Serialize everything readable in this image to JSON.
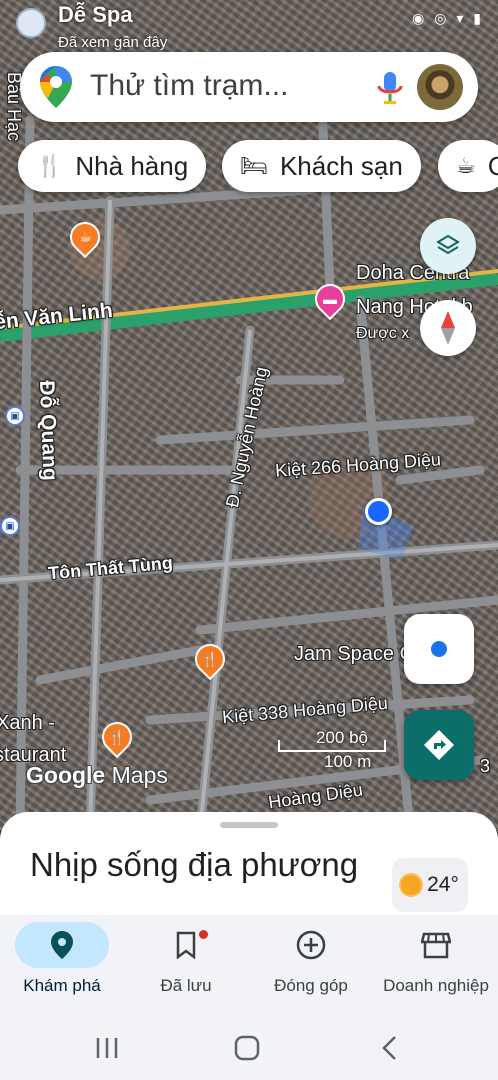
{
  "status_bar": {
    "place_name": "Dễ Spa",
    "recently_viewed": "Đã xem gần đây",
    "system_icons": "◉ ◎ ▾ ▮"
  },
  "search": {
    "placeholder": "Thử tìm trạm..."
  },
  "chips": [
    {
      "icon": "restaurant-icon",
      "label": "Nhà hàng"
    },
    {
      "icon": "hotel-icon",
      "label": "Khách sạn"
    },
    {
      "icon": "coffee-icon",
      "label": "C"
    }
  ],
  "map": {
    "streets": {
      "nguyen_van_linh": "ễn Văn Linh",
      "do_quang": "Đỗ Quang",
      "nguyen_hoang": "Đ. Nguyễn Hoàng",
      "kiet_266": "Kiệt 266 Hoàng Diệu",
      "ton_that_tung": "Tôn Thất Tùng",
      "kiet_338": "Kiệt 338 Hoàng Diệu",
      "hoang_dieu": "Hoàng Diệu",
      "bau_hac": "Bàu Hạc",
      "side_num": "3"
    },
    "pois": {
      "hotel_name_1": "Doha Centra",
      "hotel_name_2": "Nang Hotel b",
      "hotel_sub": "Được x",
      "jam_space": "Jam Space Cafe",
      "xanh_1": "Xanh -",
      "xanh_2": "staurant"
    },
    "scale": {
      "top": "200 bộ",
      "bottom": "100 m"
    },
    "watermark": {
      "google": "Google",
      "maps": "Maps"
    }
  },
  "sheet": {
    "title": "Nhịp sống địa phương",
    "temperature": "24°"
  },
  "nav": [
    {
      "icon": "explore-pin-icon",
      "label": "Khám phá",
      "active": true
    },
    {
      "icon": "bookmark-icon",
      "label": "Đã lưu",
      "active": false
    },
    {
      "icon": "add-circle-icon",
      "label": "Đóng góp",
      "active": false
    },
    {
      "icon": "storefront-icon",
      "label": "Doanh nghiệp",
      "active": false
    }
  ],
  "colors": {
    "accent_blue": "#1a73e8",
    "directions_teal": "#0b6e69",
    "hotel_pink": "#e8409a",
    "food_orange": "#f57c22",
    "nav_active": "#c2e7ff"
  }
}
